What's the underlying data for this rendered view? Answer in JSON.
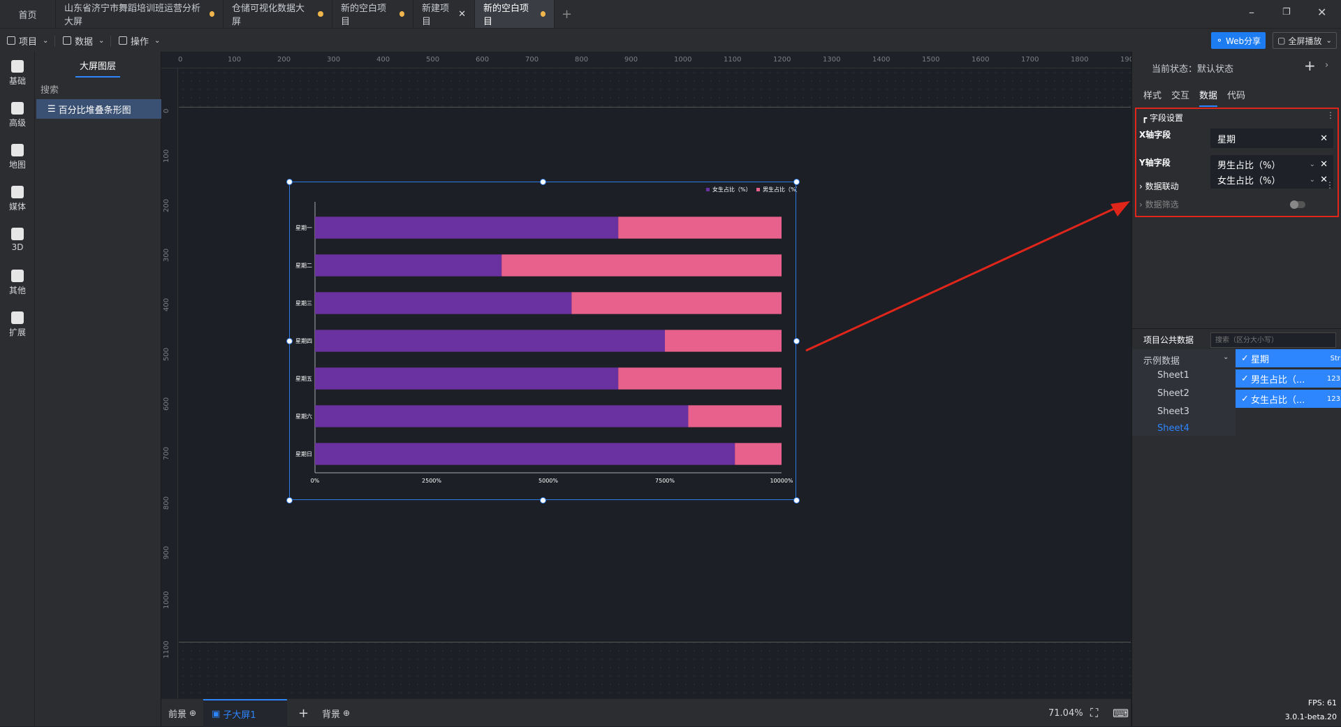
{
  "tabs": [
    {
      "label": "首页",
      "dot": false,
      "close": false,
      "active": false
    },
    {
      "label": "山东省济宁市舞蹈培训班运营分析大屏",
      "dot": true,
      "close": false,
      "active": false
    },
    {
      "label": "仓储可视化数据大屏",
      "dot": true,
      "close": false,
      "active": false
    },
    {
      "label": "新的空白项目",
      "dot": true,
      "close": false,
      "active": false
    },
    {
      "label": "新建项目",
      "dot": false,
      "close": true,
      "active": false
    },
    {
      "label": "新的空白项目",
      "dot": true,
      "close": false,
      "active": true
    }
  ],
  "new_tab": "+",
  "menu": {
    "project": "项目",
    "data": "数据",
    "operate": "操作"
  },
  "web_share": "Web分享",
  "fullscreen": "全屏播放",
  "rail": [
    "基础",
    "高级",
    "地图",
    "媒体",
    "3D",
    "其他",
    "扩展"
  ],
  "layers": {
    "title": "大屏图层",
    "search": "搜索",
    "item": "百分比堆叠条形图"
  },
  "ruler_h": [
    "0",
    "100",
    "200",
    "300",
    "400",
    "500",
    "600",
    "700",
    "800",
    "900",
    "1000",
    "1100",
    "1200",
    "1300",
    "1400",
    "1500",
    "1600",
    "1700",
    "1800",
    "1900"
  ],
  "ruler_v": [
    "0",
    "100",
    "200",
    "300",
    "400",
    "500",
    "600",
    "700",
    "800",
    "900",
    "1000",
    "1100"
  ],
  "bottom": {
    "front": "前景",
    "sub": "子大屏1",
    "add": "+",
    "back": "背景",
    "zoom": "71.04%",
    "fps": "FPS: 61",
    "version": "3.0.1-beta.20"
  },
  "right": {
    "state_label": "当前状态：默认状态",
    "tabs": [
      "样式",
      "交互",
      "数据",
      "代码"
    ],
    "active_tab": 2,
    "field_section": "字段设置",
    "x_label": "X轴字段",
    "x_value": "星期",
    "y_label": "Y轴字段",
    "y_values": [
      "男生占比（%）",
      "女生占比（%）"
    ],
    "linkage": "数据联动",
    "filter": "数据筛选",
    "public_data": "项目公共数据",
    "public_search_placeholder": "搜索（区分大小写）",
    "dataset": "示例数据",
    "sheets": [
      "Sheet1",
      "Sheet2",
      "Sheet3",
      "Sheet4"
    ],
    "active_sheet": 3,
    "columns": [
      {
        "name": "星期",
        "type": "Str"
      },
      {
        "name": "男生占比（...",
        "type": "123"
      },
      {
        "name": "女生占比（...",
        "type": "123"
      }
    ]
  },
  "chart_data": {
    "type": "bar",
    "orientation": "horizontal",
    "stacked": "percent",
    "categories": [
      "星期一",
      "星期二",
      "星期三",
      "星期四",
      "星期五",
      "星期六",
      "星期日"
    ],
    "series": [
      {
        "name": "女生占比（%）",
        "color": "#6a32a0",
        "values": [
          65,
          40,
          55,
          75,
          65,
          80,
          90
        ]
      },
      {
        "name": "男生占比（%）",
        "color": "#e8608c",
        "values": [
          35,
          60,
          45,
          25,
          35,
          20,
          10
        ]
      }
    ],
    "x_ticks": [
      "0%",
      "2500%",
      "5000%",
      "7500%",
      "10000%"
    ],
    "legend_position": "top-right"
  },
  "colors": {
    "accent": "#2e86ff",
    "highlight_border": "#e0251b",
    "arrow": "#e0251b"
  }
}
